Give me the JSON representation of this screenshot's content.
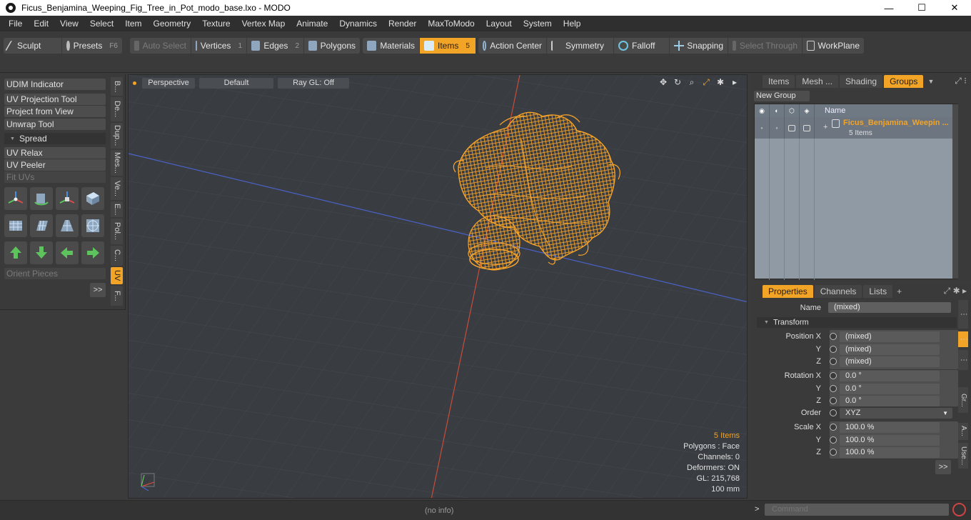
{
  "window": {
    "title": "Ficus_Benjamina_Weeping_Fig_Tree_in_Pot_modo_base.lxo - MODO",
    "minimize": "—",
    "maximize": "☐",
    "close": "✕"
  },
  "menu": [
    "File",
    "Edit",
    "View",
    "Select",
    "Item",
    "Geometry",
    "Texture",
    "Vertex Map",
    "Animate",
    "Dynamics",
    "Render",
    "MaxToModo",
    "Layout",
    "System",
    "Help"
  ],
  "toolbar": {
    "sculpt": "Sculpt",
    "presets": "Presets",
    "presets_key": "F6",
    "auto_select": "Auto Select",
    "vertices": "Vertices",
    "vertices_n": "1",
    "edges": "Edges",
    "edges_n": "2",
    "polygons": "Polygons",
    "materials": "Materials",
    "items": "Items",
    "items_n": "5",
    "action_center": "Action Center",
    "symmetry": "Symmetry",
    "falloff": "Falloff",
    "snapping": "Snapping",
    "select_through": "Select Through",
    "workplane": "WorkPlane"
  },
  "left_panel": {
    "udim": "UDIM Indicator",
    "uv_projection": "UV Projection Tool",
    "project_from_view": "Project from View",
    "unwrap": "Unwrap Tool",
    "spread": "Spread",
    "uv_relax": "UV Relax",
    "uv_peeler": "UV Peeler",
    "fit_uvs": "Fit UVs",
    "orient_pieces": "Orient Pieces",
    "more": ">>",
    "vtabs": [
      "B...",
      "De...",
      "Dup...",
      "Mes...",
      "Ve...",
      "E...",
      "Pol...",
      "C...",
      "UV",
      "F..."
    ]
  },
  "viewport": {
    "view": "Perspective",
    "shading": "Default",
    "raygl": "Ray GL: Off",
    "info_items": "5 Items",
    "info_polygons": "Polygons : Face",
    "info_channels": "Channels: 0",
    "info_deformers": "Deformers: ON",
    "info_gl": "GL: 215,768",
    "info_scale": "100 mm"
  },
  "groups_panel": {
    "tabs": [
      "Items",
      "Mesh ...",
      "Shading",
      "Groups"
    ],
    "new_group": "New Group",
    "col_name": "Name",
    "group_name": "Ficus_Benjamina_Weepin ...",
    "group_sub": "5 Items"
  },
  "properties_panel": {
    "tabs": [
      "Properties",
      "Channels",
      "Lists"
    ],
    "add_tab": "+",
    "name_label": "Name",
    "name_value": "(mixed)",
    "transform": "Transform",
    "position_x_label": "Position X",
    "y_label": "Y",
    "z_label": "Z",
    "position_x": "(mixed)",
    "position_y": "(mixed)",
    "position_z": "(mixed)",
    "rotation_x_label": "Rotation X",
    "rotation_x": "0.0 °",
    "rotation_y": "0.0 °",
    "rotation_z": "0.0 °",
    "order_label": "Order",
    "order_value": "XYZ",
    "scale_x_label": "Scale X",
    "scale_x": "100.0 %",
    "scale_y": "100.0 %",
    "scale_z": "100.0 %",
    "more": ">>",
    "side_tabs": [
      "Gr...",
      "A...",
      "Use..."
    ]
  },
  "status": {
    "no_info": "(no info)",
    "cmd_arrow": ">",
    "command_placeholder": "Command"
  },
  "colors": {
    "accent": "#f2a427",
    "wire": "#f7a42a",
    "axis_red": "#c84c3c",
    "axis_blue": "#4a62c8"
  }
}
